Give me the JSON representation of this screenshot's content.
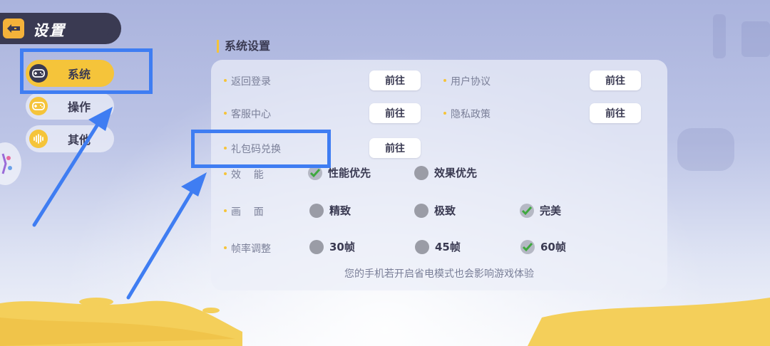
{
  "header": {
    "back_icon": "back-arrow-icon",
    "title": "设置"
  },
  "sidebar": {
    "items": [
      {
        "label": "系统",
        "icon": "gamepad-icon",
        "active": true
      },
      {
        "label": "操作",
        "icon": "controller-icon",
        "active": false
      },
      {
        "label": "其他",
        "icon": "soundwave-icon",
        "active": false
      }
    ]
  },
  "section": {
    "title": "系统设置"
  },
  "rows": {
    "return_login": {
      "label": "返回登录",
      "button": "前往"
    },
    "user_agreement": {
      "label": "用户协议",
      "button": "前往"
    },
    "customer_service": {
      "label": "客服中心",
      "button": "前往"
    },
    "privacy_policy": {
      "label": "隐私政策",
      "button": "前往"
    },
    "gift_code": {
      "label": "礼包码兑换",
      "button": "前往"
    }
  },
  "performance": {
    "label": "效    能",
    "options": [
      {
        "label": "性能优先",
        "checked": true
      },
      {
        "label": "效果优先",
        "checked": false
      }
    ]
  },
  "graphics": {
    "label": "画    面",
    "options": [
      {
        "label": "精致",
        "checked": false
      },
      {
        "label": "极致",
        "checked": false
      },
      {
        "label": "完美",
        "checked": true
      }
    ]
  },
  "framerate": {
    "label": "帧率调整",
    "options": [
      {
        "label": "30帧",
        "checked": false
      },
      {
        "label": "45帧",
        "checked": false
      },
      {
        "label": "60帧",
        "checked": true
      }
    ]
  },
  "hint": "您的手机若开启省电模式也会影响游戏体验",
  "colors": {
    "accent": "#f5c43a",
    "header_bg": "#3a3a52",
    "annotation": "#3f7df2",
    "check": "#4caf50"
  }
}
